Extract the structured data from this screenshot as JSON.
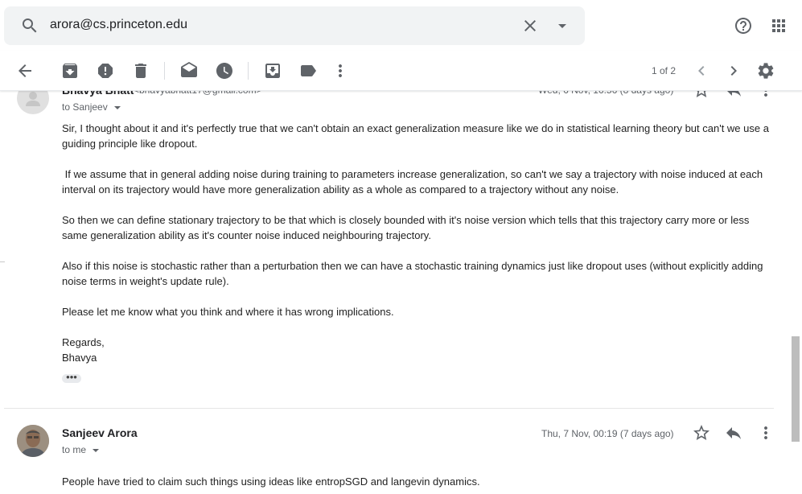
{
  "search": {
    "value": "arora@cs.princeton.edu"
  },
  "toolbar": {
    "pager": "1 of 2",
    "icons": [
      "back-arrow-icon",
      "archive-icon",
      "report-spam-icon",
      "delete-icon",
      "mark-unread-icon",
      "snooze-icon",
      "move-to-icon",
      "label-icon",
      "more-vert-icon",
      "chevron-left-icon",
      "chevron-right-icon",
      "settings-icon"
    ]
  },
  "message1": {
    "sender": "Bhavya Bhatt",
    "email": "<bhavyabhatt17@gmail.com>",
    "to": "to Sanjeev",
    "date": "Wed, 6 Nov, 16:56 (8 days ago)",
    "paragraphs": [
      "Sir, I thought about it and it's perfectly true that we can't obtain an exact generalization measure like we do in statistical learning theory but can't we use a guiding principle like dropout.",
      " If we assume that in general adding noise during training to parameters increase generalization, so can't we say a trajectory with noise induced at each interval on its trajectory would have more generalization ability as a whole as compared to a trajectory without any noise.",
      "So then we can define stationary trajectory to be that which is closely bounded with it's noise version which tells that this trajectory carry more or less same generalization ability as it's counter noise induced neighbouring trajectory.",
      "Also if this noise is stochastic rather than a perturbation then we can have a stochastic training dynamics just like dropout uses (without explicitly adding noise terms in weight's update rule).",
      "Please let me know what you think and where it has wrong implications.",
      "Regards,\nBhavya"
    ],
    "ellipsis": "•••"
  },
  "message2": {
    "sender": "Sanjeev Arora",
    "to": "to me",
    "date": "Thu, 7 Nov, 00:19 (7 days ago)",
    "body": "People have tried to claim such things using ideas like entropSGD and langevin dynamics."
  },
  "colors": {
    "icon": "#5f6368",
    "searchBg": "#f1f3f4"
  }
}
